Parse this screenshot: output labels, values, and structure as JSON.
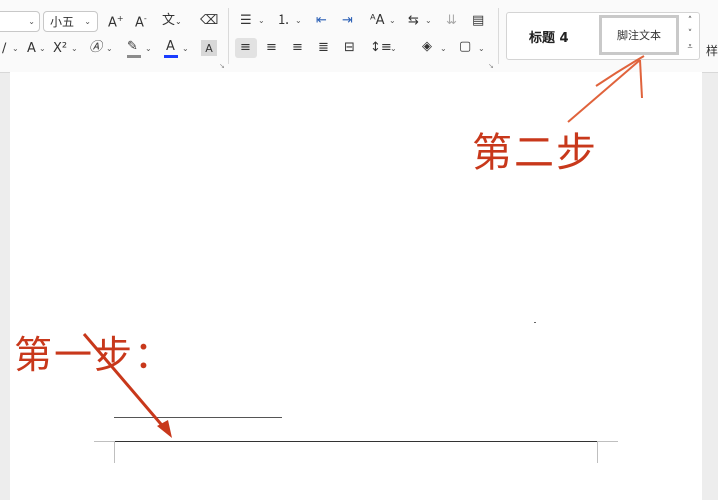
{
  "toolbar": {
    "font_size_value": "小五",
    "color_icon_label": "A",
    "style_panel": {
      "heading4_label": "标题 4",
      "footnote_label": "脚注文本",
      "side_label": "样"
    },
    "colors": {
      "font_color_underline": "#1a3cff",
      "highlight_underline": "#8c8c8c"
    }
  },
  "annotations": {
    "step2": "第二步",
    "step1": "第一步：",
    "color": "#c8381b"
  }
}
